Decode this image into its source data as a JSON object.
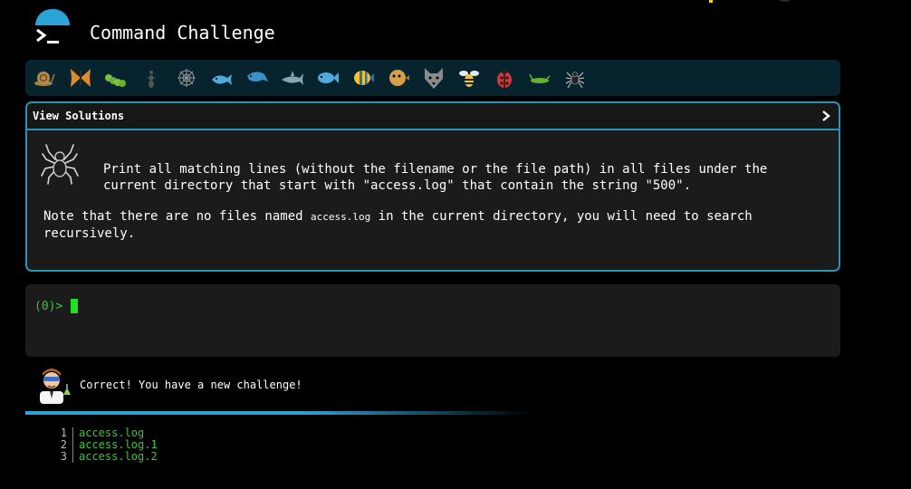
{
  "app": {
    "title": "Command Challenge"
  },
  "animal_bar": {
    "animals": [
      "snail",
      "butterfly",
      "caterpillar",
      "ant",
      "spider-web",
      "whale",
      "dolphin",
      "shark",
      "fish",
      "tropical-fish",
      "blowfish",
      "wolf",
      "bee",
      "ladybug",
      "cricket",
      "spider"
    ]
  },
  "challenge": {
    "view_solutions_label": "View Solutions",
    "text": "Print all matching lines (without the filename or the file path) in all files under the\ncurrent directory that start with \"access.log\" that contain the string \"500\".",
    "note_prefix": "Note that there are no files named ",
    "note_code": "access.log",
    "note_suffix": " in the current directory, you will need to search recursively."
  },
  "terminal": {
    "prompt": "(0)>"
  },
  "feedback": {
    "message": "Correct! You have a new challenge!"
  },
  "output": {
    "lines": [
      {
        "num": "1",
        "text": "access.log"
      },
      {
        "num": "2",
        "text": "access.log.1"
      },
      {
        "num": "3",
        "text": "access.log.2"
      }
    ]
  },
  "colors": {
    "accent": "#2aa4d9",
    "panel_border": "#2a93b8",
    "terminal_green": "#3ec43e",
    "cursor_green": "#22e022",
    "bar_background": "#07232d"
  }
}
